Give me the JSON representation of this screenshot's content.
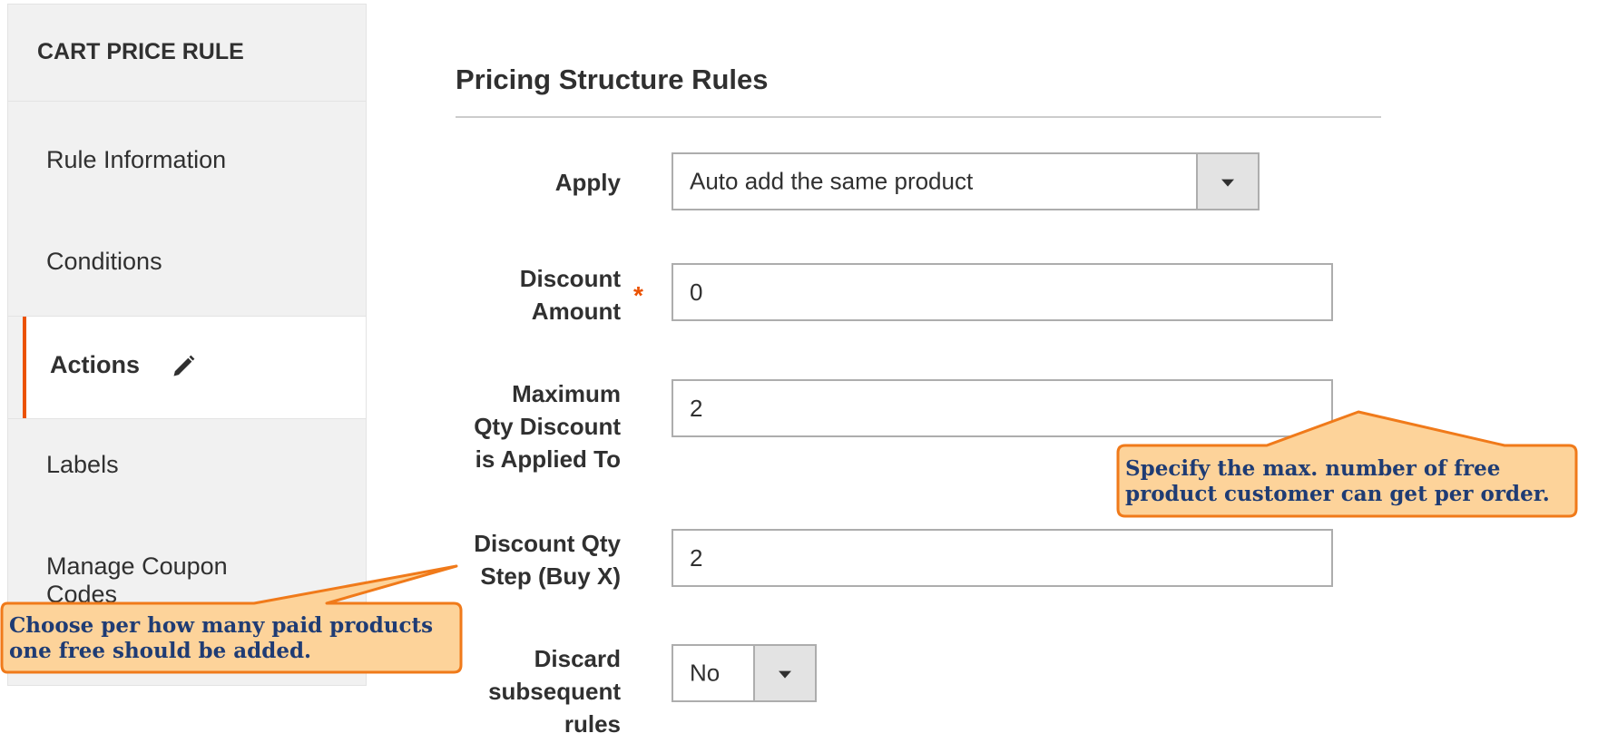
{
  "sidebar": {
    "title": "CART PRICE RULE",
    "items": [
      {
        "label": "Rule Information",
        "active": false
      },
      {
        "label": "Conditions",
        "active": false
      },
      {
        "label": "Actions",
        "active": true
      },
      {
        "label": "Labels",
        "active": false
      },
      {
        "label": "Manage Coupon Codes",
        "active": false
      }
    ]
  },
  "main": {
    "section_title": "Pricing Structure Rules",
    "fields": {
      "apply": {
        "label": "Apply",
        "value": "Auto add the same product"
      },
      "discount_amount": {
        "label_line1": "Discount",
        "label_line2": "Amount",
        "required": true,
        "required_mark": "*",
        "value": "0"
      },
      "max_qty": {
        "label_line1": "Maximum",
        "label_line2": "Qty Discount",
        "label_line3": "is Applied To",
        "value": "2"
      },
      "discount_step": {
        "label_line1": "Discount Qty",
        "label_line2": "Step (Buy X)",
        "value": "2"
      },
      "discard_rules": {
        "label_line1": "Discard",
        "label_line2": "subsequent",
        "label_line3": "rules",
        "value": "No"
      }
    }
  },
  "callouts": {
    "max_qty": {
      "line1": "Specify the max. number of free",
      "line2": "product customer can get per order."
    },
    "discount_step": {
      "line1": "Choose per how many paid products",
      "line2": "one free should be added."
    }
  },
  "colors": {
    "accent": "#eb5202",
    "callout_fill": "#fdd39a",
    "callout_border": "#f07a1a",
    "callout_text": "#1f3c74",
    "sidebar_bg": "#f1f1f1"
  }
}
